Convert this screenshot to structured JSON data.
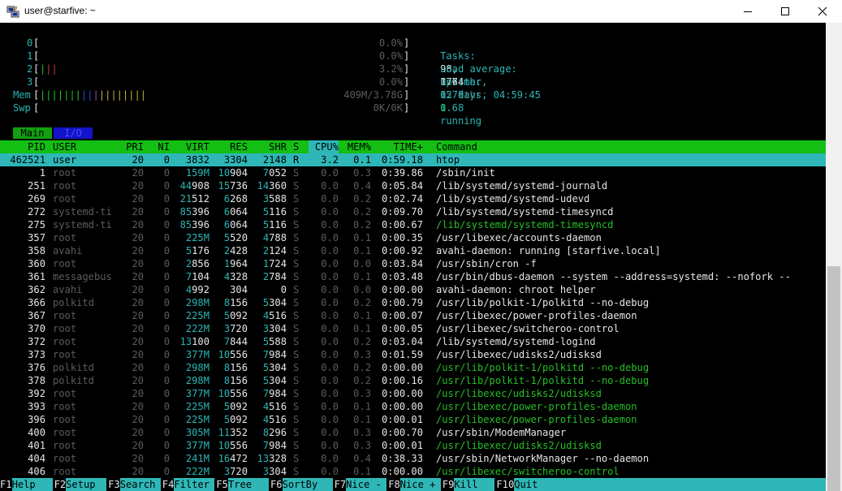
{
  "window": {
    "title": "user@starfive: ~"
  },
  "meters": {
    "cpu": [
      {
        "label": "0",
        "value": "0.0%"
      },
      {
        "label": "1",
        "value": "0.0%"
      },
      {
        "label": "2",
        "value": "3.2%"
      },
      {
        "label": "3",
        "value": "0.0%"
      }
    ],
    "mem": {
      "label": "Mem",
      "value": "409M/3.78G"
    },
    "swp": {
      "label": "Swp",
      "value": "0K/0K"
    },
    "tasks": {
      "label": "Tasks:",
      "tasks": "98,",
      "thr": "176",
      "thr_label": "thr,",
      "kthr": "85",
      "kthr_label": "kthr;",
      "running": "1",
      "running_label": "running"
    },
    "load": {
      "label": "Load average:",
      "v1": "0.74",
      "v2": "0.70",
      "v3": "0.68"
    },
    "uptime": {
      "label": "Uptime:",
      "value": "12 days, 04:59:45"
    }
  },
  "tabs": [
    {
      "label": "Main"
    },
    {
      "label": "I/O"
    }
  ],
  "columns": [
    "PID",
    "USER",
    "PRI",
    "NI",
    "VIRT",
    "RES",
    "SHR",
    "S",
    "CPU%",
    "MEM%",
    "TIME+",
    "Command"
  ],
  "processes": [
    {
      "pid": "462521",
      "user": "user",
      "pri": "20",
      "ni": "0",
      "virt": "3832",
      "res": "3304",
      "shr": "2148",
      "s": "R",
      "cpu": "3.2",
      "mem": "0.1",
      "time": "0:59.18",
      "cmd": "htop",
      "selected": true
    },
    {
      "pid": "1",
      "user": "root",
      "pri": "20",
      "ni": "0",
      "virt": "159M",
      "res": "10904",
      "shr": "7052",
      "s": "S",
      "cpu": "0.0",
      "mem": "0.3",
      "time": "0:39.86",
      "cmd": "/sbin/init"
    },
    {
      "pid": "251",
      "user": "root",
      "pri": "20",
      "ni": "0",
      "virt": "44908",
      "res": "15736",
      "shr": "14360",
      "s": "S",
      "cpu": "0.0",
      "mem": "0.4",
      "time": "0:05.84",
      "cmd": "/lib/systemd/systemd-journald"
    },
    {
      "pid": "269",
      "user": "root",
      "pri": "20",
      "ni": "0",
      "virt": "21512",
      "res": "6268",
      "shr": "3588",
      "s": "S",
      "cpu": "0.0",
      "mem": "0.2",
      "time": "0:02.74",
      "cmd": "/lib/systemd/systemd-udevd"
    },
    {
      "pid": "272",
      "user": "systemd-ti",
      "pri": "20",
      "ni": "0",
      "virt": "85396",
      "res": "6064",
      "shr": "5116",
      "s": "S",
      "cpu": "0.0",
      "mem": "0.2",
      "time": "0:09.70",
      "cmd": "/lib/systemd/systemd-timesyncd"
    },
    {
      "pid": "275",
      "user": "systemd-ti",
      "pri": "20",
      "ni": "0",
      "virt": "85396",
      "res": "6064",
      "shr": "5116",
      "s": "S",
      "cpu": "0.0",
      "mem": "0.2",
      "time": "0:00.67",
      "cmd": "/lib/systemd/systemd-timesyncd",
      "thread": true
    },
    {
      "pid": "357",
      "user": "root",
      "pri": "20",
      "ni": "0",
      "virt": "225M",
      "res": "5520",
      "shr": "4788",
      "s": "S",
      "cpu": "0.0",
      "mem": "0.1",
      "time": "0:00.35",
      "cmd": "/usr/libexec/accounts-daemon"
    },
    {
      "pid": "358",
      "user": "avahi",
      "pri": "20",
      "ni": "0",
      "virt": "5176",
      "res": "2428",
      "shr": "2124",
      "s": "S",
      "cpu": "0.0",
      "mem": "0.1",
      "time": "0:00.92",
      "cmd": "avahi-daemon: running [starfive.local]"
    },
    {
      "pid": "360",
      "user": "root",
      "pri": "20",
      "ni": "0",
      "virt": "2856",
      "res": "1964",
      "shr": "1724",
      "s": "S",
      "cpu": "0.0",
      "mem": "0.0",
      "time": "0:03.84",
      "cmd": "/usr/sbin/cron -f"
    },
    {
      "pid": "361",
      "user": "messagebus",
      "pri": "20",
      "ni": "0",
      "virt": "7104",
      "res": "4328",
      "shr": "2784",
      "s": "S",
      "cpu": "0.0",
      "mem": "0.1",
      "time": "0:03.48",
      "cmd": "/usr/bin/dbus-daemon --system --address=systemd: --nofork --"
    },
    {
      "pid": "362",
      "user": "avahi",
      "pri": "20",
      "ni": "0",
      "virt": "4992",
      "res": "304",
      "shr": "0",
      "s": "S",
      "cpu": "0.0",
      "mem": "0.0",
      "time": "0:00.00",
      "cmd": "avahi-daemon: chroot helper"
    },
    {
      "pid": "366",
      "user": "polkitd",
      "pri": "20",
      "ni": "0",
      "virt": "298M",
      "res": "8156",
      "shr": "5304",
      "s": "S",
      "cpu": "0.0",
      "mem": "0.2",
      "time": "0:00.79",
      "cmd": "/usr/lib/polkit-1/polkitd --no-debug"
    },
    {
      "pid": "367",
      "user": "root",
      "pri": "20",
      "ni": "0",
      "virt": "225M",
      "res": "5092",
      "shr": "4516",
      "s": "S",
      "cpu": "0.0",
      "mem": "0.1",
      "time": "0:00.07",
      "cmd": "/usr/libexec/power-profiles-daemon"
    },
    {
      "pid": "370",
      "user": "root",
      "pri": "20",
      "ni": "0",
      "virt": "222M",
      "res": "3720",
      "shr": "3304",
      "s": "S",
      "cpu": "0.0",
      "mem": "0.1",
      "time": "0:00.05",
      "cmd": "/usr/libexec/switcheroo-control"
    },
    {
      "pid": "372",
      "user": "root",
      "pri": "20",
      "ni": "0",
      "virt": "13100",
      "res": "7844",
      "shr": "5588",
      "s": "S",
      "cpu": "0.0",
      "mem": "0.2",
      "time": "0:03.04",
      "cmd": "/lib/systemd/systemd-logind"
    },
    {
      "pid": "373",
      "user": "root",
      "pri": "20",
      "ni": "0",
      "virt": "377M",
      "res": "10556",
      "shr": "7984",
      "s": "S",
      "cpu": "0.0",
      "mem": "0.3",
      "time": "0:01.59",
      "cmd": "/usr/libexec/udisks2/udisksd"
    },
    {
      "pid": "376",
      "user": "polkitd",
      "pri": "20",
      "ni": "0",
      "virt": "298M",
      "res": "8156",
      "shr": "5304",
      "s": "S",
      "cpu": "0.0",
      "mem": "0.2",
      "time": "0:00.00",
      "cmd": "/usr/lib/polkit-1/polkitd --no-debug",
      "thread": true
    },
    {
      "pid": "378",
      "user": "polkitd",
      "pri": "20",
      "ni": "0",
      "virt": "298M",
      "res": "8156",
      "shr": "5304",
      "s": "S",
      "cpu": "0.0",
      "mem": "0.2",
      "time": "0:00.16",
      "cmd": "/usr/lib/polkit-1/polkitd --no-debug",
      "thread": true
    },
    {
      "pid": "392",
      "user": "root",
      "pri": "20",
      "ni": "0",
      "virt": "377M",
      "res": "10556",
      "shr": "7984",
      "s": "S",
      "cpu": "0.0",
      "mem": "0.3",
      "time": "0:00.00",
      "cmd": "/usr/libexec/udisks2/udisksd",
      "thread": true
    },
    {
      "pid": "393",
      "user": "root",
      "pri": "20",
      "ni": "0",
      "virt": "225M",
      "res": "5092",
      "shr": "4516",
      "s": "S",
      "cpu": "0.0",
      "mem": "0.1",
      "time": "0:00.00",
      "cmd": "/usr/libexec/power-profiles-daemon",
      "thread": true
    },
    {
      "pid": "396",
      "user": "root",
      "pri": "20",
      "ni": "0",
      "virt": "225M",
      "res": "5092",
      "shr": "4516",
      "s": "S",
      "cpu": "0.0",
      "mem": "0.1",
      "time": "0:00.01",
      "cmd": "/usr/libexec/power-profiles-daemon",
      "thread": true
    },
    {
      "pid": "400",
      "user": "root",
      "pri": "20",
      "ni": "0",
      "virt": "305M",
      "res": "11352",
      "shr": "8296",
      "s": "S",
      "cpu": "0.0",
      "mem": "0.3",
      "time": "0:00.70",
      "cmd": "/usr/sbin/ModemManager"
    },
    {
      "pid": "401",
      "user": "root",
      "pri": "20",
      "ni": "0",
      "virt": "377M",
      "res": "10556",
      "shr": "7984",
      "s": "S",
      "cpu": "0.0",
      "mem": "0.3",
      "time": "0:00.01",
      "cmd": "/usr/libexec/udisks2/udisksd",
      "thread": true
    },
    {
      "pid": "404",
      "user": "root",
      "pri": "20",
      "ni": "0",
      "virt": "241M",
      "res": "16472",
      "shr": "13328",
      "s": "S",
      "cpu": "0.0",
      "mem": "0.4",
      "time": "0:38.33",
      "cmd": "/usr/sbin/NetworkManager --no-daemon"
    },
    {
      "pid": "406",
      "user": "root",
      "pri": "20",
      "ni": "0",
      "virt": "222M",
      "res": "3720",
      "shr": "3304",
      "s": "S",
      "cpu": "0.0",
      "mem": "0.1",
      "time": "0:00.00",
      "cmd": "/usr/libexec/switcheroo-control",
      "thread": true
    }
  ],
  "function_keys": [
    {
      "key": "F1",
      "label": "Help"
    },
    {
      "key": "F2",
      "label": "Setup"
    },
    {
      "key": "F3",
      "label": "Search"
    },
    {
      "key": "F4",
      "label": "Filter"
    },
    {
      "key": "F5",
      "label": "Tree"
    },
    {
      "key": "F6",
      "label": "SortBy"
    },
    {
      "key": "F7",
      "label": "Nice -"
    },
    {
      "key": "F8",
      "label": "Nice +"
    },
    {
      "key": "F9",
      "label": "Kill"
    },
    {
      "key": "F10",
      "label": "Quit"
    }
  ],
  "colors": {
    "header_bg": "#13bf13",
    "selected_bg": "#2fb7b7",
    "terminal_bg": "#000000",
    "cyan": "#2bb5b5",
    "green": "#26bf26"
  },
  "icons": {
    "app": "putty-icon",
    "minimize": "minimize-icon",
    "maximize": "maximize-icon",
    "close": "close-icon"
  }
}
